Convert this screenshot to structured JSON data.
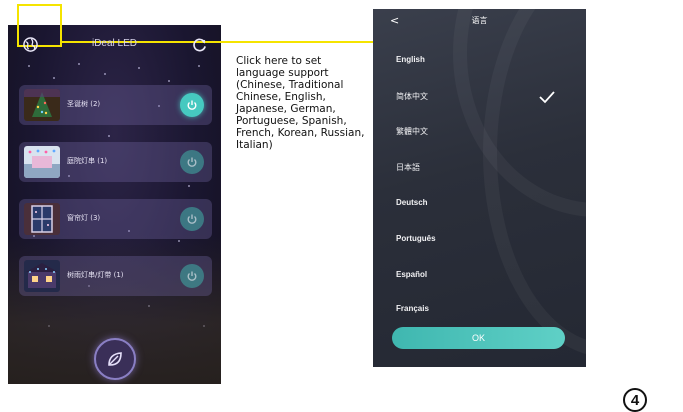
{
  "left_screen": {
    "title": "iDeal LED",
    "devices": [
      {
        "name": "圣诞树 (2)",
        "power": "on"
      },
      {
        "name": "庭院灯串 (1)",
        "power": "off"
      },
      {
        "name": "窗帘灯 (3)",
        "power": "off"
      },
      {
        "name": "树雨灯串/灯带 (1)",
        "power": "off"
      }
    ]
  },
  "callout": {
    "text": "Click here to set language support (Chinese, Traditional Chinese, English, Japanese, German, Portuguese, Spanish, French, Korean, Russian, Italian)"
  },
  "right_screen": {
    "back": "<",
    "title": "语言",
    "languages": [
      "English",
      "简体中文",
      "繁體中文",
      "日本語",
      "Deutsch",
      "Português",
      "Español",
      "Français"
    ],
    "selected": "简体中文",
    "ok_label": "OK"
  },
  "page_number": "4",
  "colors": {
    "highlight": "#f5e400",
    "accent": "#46c9c0"
  }
}
